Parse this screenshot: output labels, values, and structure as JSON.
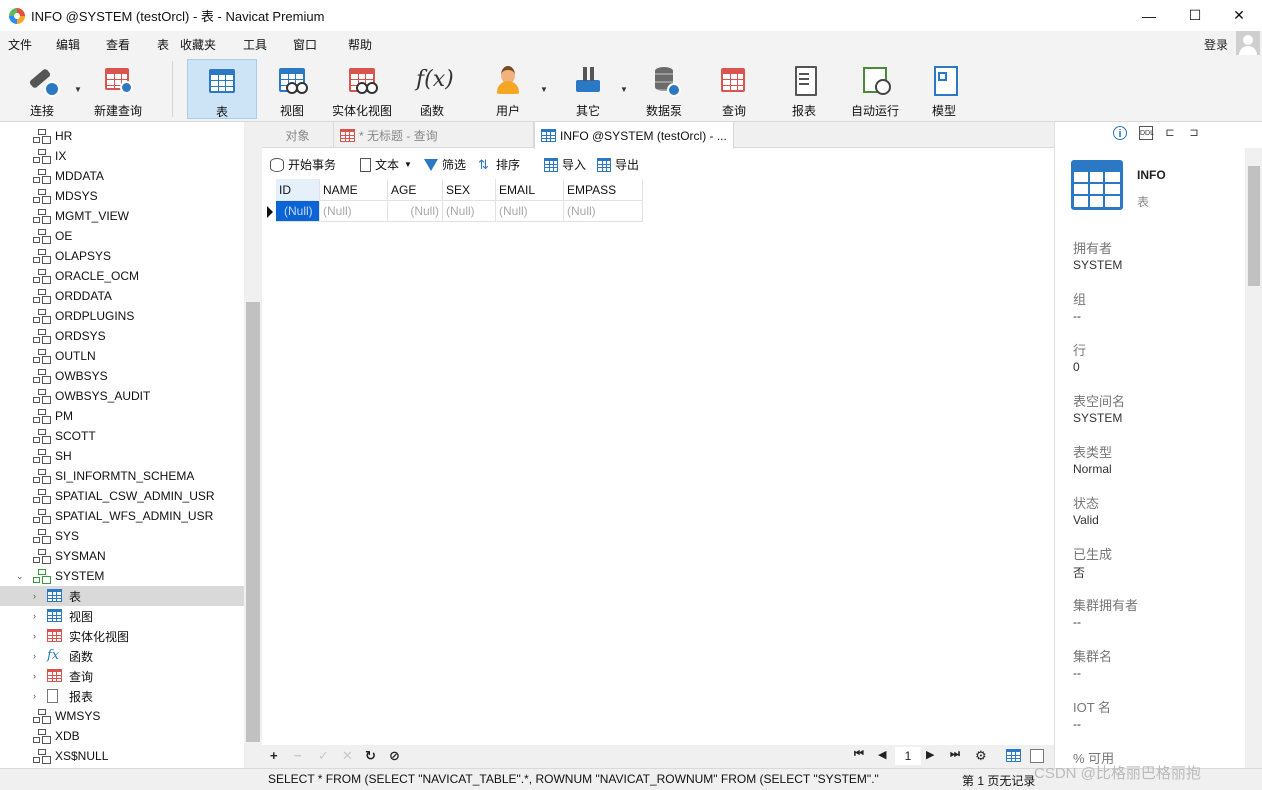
{
  "window": {
    "title": "INFO @SYSTEM (testOrcl) - 表 - Navicat Premium",
    "minimize": "—",
    "maximize": "☐",
    "close": "✕"
  },
  "menu": {
    "items": [
      "文件",
      "编辑",
      "查看",
      "表",
      "收藏夹",
      "工具",
      "窗口",
      "帮助"
    ],
    "login": "登录"
  },
  "toolbar": {
    "buttons": [
      {
        "label": "连接",
        "icon": "plug-icon"
      },
      {
        "label": "新建查询",
        "icon": "new-query-icon"
      },
      {
        "label": "表",
        "icon": "table-icon",
        "active": true
      },
      {
        "label": "视图",
        "icon": "view-icon"
      },
      {
        "label": "实体化视图",
        "icon": "materialized-view-icon"
      },
      {
        "label": "函数",
        "icon": "function-icon"
      },
      {
        "label": "用户",
        "icon": "user-icon"
      },
      {
        "label": "其它",
        "icon": "tools-icon"
      },
      {
        "label": "数据泵",
        "icon": "datapump-icon"
      },
      {
        "label": "查询",
        "icon": "query-icon"
      },
      {
        "label": "报表",
        "icon": "report-icon"
      },
      {
        "label": "自动运行",
        "icon": "automation-icon"
      },
      {
        "label": "模型",
        "icon": "model-icon"
      }
    ]
  },
  "sidebar": {
    "schemas": [
      "HR",
      "IX",
      "MDDATA",
      "MDSYS",
      "MGMT_VIEW",
      "OE",
      "OLAPSYS",
      "ORACLE_OCM",
      "ORDDATA",
      "ORDPLUGINS",
      "ORDSYS",
      "OUTLN",
      "OWBSYS",
      "OWBSYS_AUDIT",
      "PM",
      "SCOTT",
      "SH",
      "SI_INFORMTN_SCHEMA",
      "SPATIAL_CSW_ADMIN_USR",
      "SPATIAL_WFS_ADMIN_USR",
      "SYS",
      "SYSMAN",
      "SYSTEM"
    ],
    "expanded_schema": "SYSTEM",
    "children": [
      "表",
      "视图",
      "实体化视图",
      "函数",
      "查询",
      "报表"
    ],
    "selected_child": "表",
    "schemas_after": [
      "WMSYS",
      "XDB",
      "XS$NULL"
    ]
  },
  "tabs": [
    {
      "label": "对象",
      "state": "inactive"
    },
    {
      "label": "* 无标题 - 查询",
      "state": "inactive"
    },
    {
      "label": "INFO @SYSTEM (testOrcl) - ...",
      "state": "active"
    }
  ],
  "data_toolbar": {
    "begin_transaction": "开始事务",
    "text": "文本",
    "filter": "筛选",
    "sort": "排序",
    "import": "导入",
    "export": "导出"
  },
  "grid": {
    "columns": [
      "ID",
      "NAME",
      "AGE",
      "SEX",
      "EMAIL",
      "EMPASS"
    ],
    "rows": [
      [
        "(Null)",
        "(Null)",
        "(Null)",
        "(Null)",
        "(Null)",
        "(Null)"
      ]
    ]
  },
  "pager": {
    "page": "1"
  },
  "info_panel": {
    "name": "INFO",
    "type": "表",
    "properties": [
      {
        "label": "拥有者",
        "value": "SYSTEM"
      },
      {
        "label": "组",
        "value": "--"
      },
      {
        "label": "行",
        "value": "0"
      },
      {
        "label": "表空间名",
        "value": "SYSTEM"
      },
      {
        "label": "表类型",
        "value": "Normal"
      },
      {
        "label": "状态",
        "value": "Valid"
      },
      {
        "label": "已生成",
        "value": "否"
      },
      {
        "label": "集群拥有者",
        "value": "--"
      },
      {
        "label": "集群名",
        "value": "--"
      },
      {
        "label": "IOT 名",
        "value": "--"
      },
      {
        "label": "% 可用",
        "value": ""
      }
    ]
  },
  "status": {
    "sql": "SELECT * FROM (SELECT \"NAVICAT_TABLE\".*, ROWNUM \"NAVICAT_ROWNUM\" FROM (SELECT \"SYSTEM\".\"",
    "records": "第 1 页无记录"
  },
  "watermark": "CSDN @比格丽巴格丽抱",
  "colors": {
    "accent": "#2b78c4",
    "selection": "#0a64d6",
    "active_toolbar": "#cde4f7"
  }
}
